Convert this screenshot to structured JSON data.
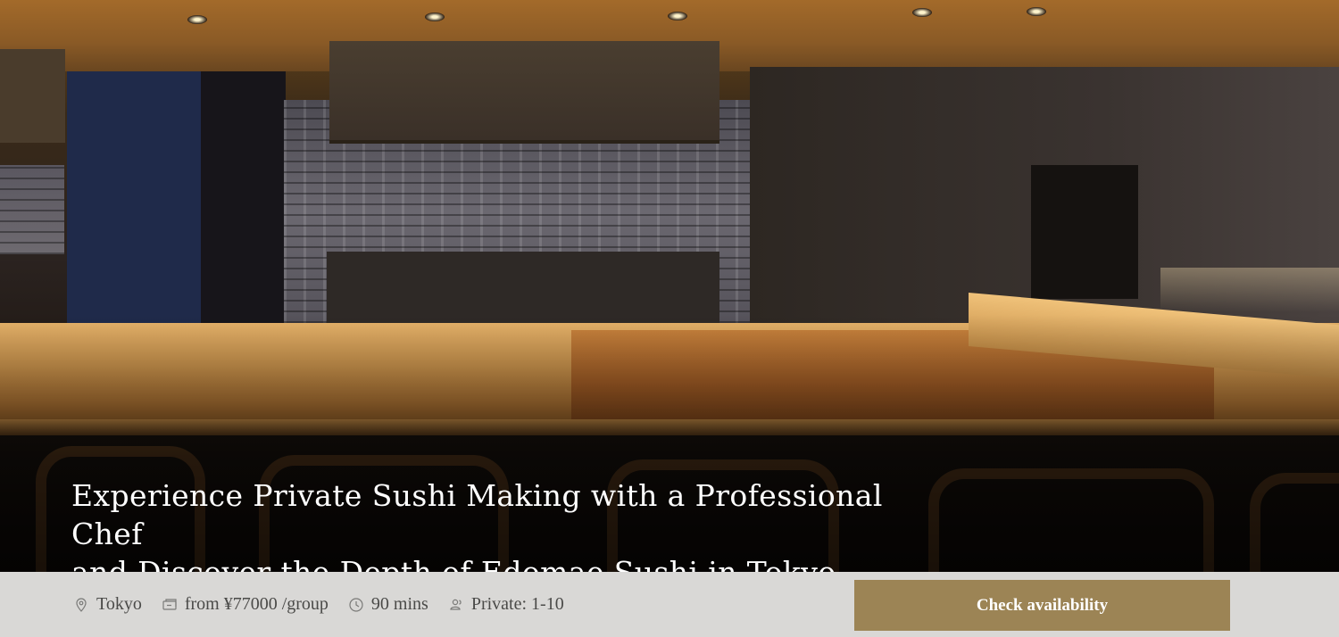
{
  "hero": {
    "title_line1": "Experience Private Sushi Making with a Professional Chef",
    "title_line2": "and Discover the Depth of Edomae Sushi in Tokyo"
  },
  "info": {
    "location": "Tokyo",
    "price": "from ¥77000 /group",
    "duration": "90 mins",
    "group": "Private: 1-10"
  },
  "cta": {
    "label": "Check availability"
  },
  "icons": [
    "location-pin-icon",
    "ticket-icon",
    "clock-icon",
    "people-icon"
  ],
  "colors": {
    "cta_background": "#9c8455",
    "info_bar": "#d9d8d6",
    "meta_text": "#4a4a48"
  }
}
